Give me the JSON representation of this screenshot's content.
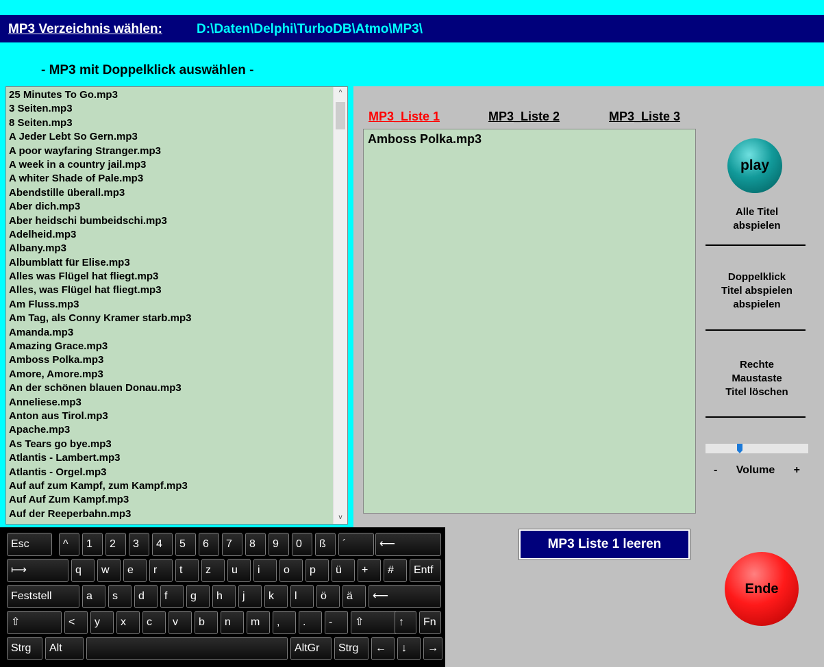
{
  "header": {
    "label": "MP3 Verzeichnis wählen:",
    "path": "D:\\Daten\\Delphi\\TurboDB\\Atmo\\MP3\\"
  },
  "hint": "- MP3 mit Doppelklick auswählen -",
  "file_list": [
    "25 Minutes To Go.mp3",
    "3 Seiten.mp3",
    "8 Seiten.mp3",
    "A Jeder Lebt So Gern.mp3",
    "A poor wayfaring Stranger.mp3",
    "A week in a country jail.mp3",
    "A whiter Shade of Pale.mp3",
    "Abendstille überall.mp3",
    "Aber dich.mp3",
    "Aber heidschi bumbeidschi.mp3",
    "Adelheid.mp3",
    "Albany.mp3",
    "Albumblatt für Elise.mp3",
    "Alles was Flügel hat fliegt.mp3",
    "Alles, was Flügel hat fliegt.mp3",
    "Am Fluss.mp3",
    "Am Tag, als Conny Kramer starb.mp3",
    "Amanda.mp3",
    "Amazing Grace.mp3",
    "Amboss Polka.mp3",
    "Amore, Amore.mp3",
    "An der schönen blauen Donau.mp3",
    "Anneliese.mp3",
    "Anton aus Tirol.mp3",
    "Apache.mp3",
    "As Tears go bye.mp3",
    "Atlantis - Lambert.mp3",
    "Atlantis - Orgel.mp3",
    "Auf auf zum Kampf, zum Kampf.mp3",
    "Auf Auf Zum Kampf.mp3",
    "Auf der Reeperbahn.mp3"
  ],
  "tabs": [
    {
      "label": "MP3_Liste 1",
      "active": true
    },
    {
      "label": "MP3_Liste 2",
      "active": false
    },
    {
      "label": "MP3_Liste 3",
      "active": false
    }
  ],
  "playlist": [
    "Amboss Polka.mp3"
  ],
  "play_button": "play",
  "side": {
    "play_all": [
      "Alle Titel",
      "abspielen"
    ],
    "double_click": [
      "Doppelklick",
      "Titel abspielen",
      "abspielen"
    ],
    "right_click": [
      "Rechte",
      "Maustaste",
      "Titel löschen"
    ]
  },
  "volume": {
    "minus": "-",
    "label": "Volume",
    "plus": "+",
    "level": 0.33
  },
  "clear_button": "MP3 Liste 1 leeren",
  "end_button": "Ende",
  "colors": {
    "active_tab": "#ff0000",
    "header_bg": "#00007b",
    "background": "#00ffff",
    "list_bg": "#c0dcc0"
  },
  "keyboard": [
    [
      "Esc",
      "^",
      "1",
      "2",
      "3",
      "4",
      "5",
      "6",
      "7",
      "8",
      "9",
      "0",
      "ß",
      "´",
      "⟵"
    ],
    [
      "⟼",
      "q",
      "w",
      "e",
      "r",
      "t",
      "z",
      "u",
      "i",
      "o",
      "p",
      "ü",
      "+",
      "#",
      "Entf"
    ],
    [
      "Feststell",
      "a",
      "s",
      "d",
      "f",
      "g",
      "h",
      "j",
      "k",
      "l",
      "ö",
      "ä",
      "⟵"
    ],
    [
      "⇧",
      "<",
      "y",
      "x",
      "c",
      "v",
      "b",
      "n",
      "m",
      ",",
      ".",
      "-",
      "⇧",
      "↑",
      "Fn"
    ],
    [
      "Strg",
      "Alt",
      "",
      "AltGr",
      "Strg",
      "←",
      "↓",
      "→"
    ]
  ]
}
